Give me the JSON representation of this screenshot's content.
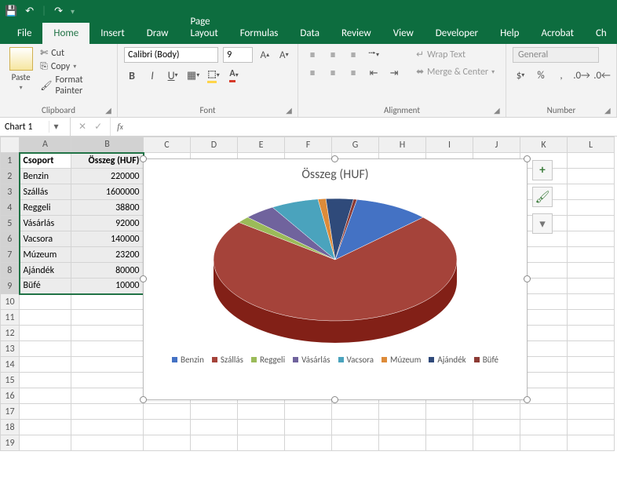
{
  "titlebar": {
    "save": "💾",
    "undo": "↶",
    "redo": "↷"
  },
  "tabs": [
    "File",
    "Home",
    "Insert",
    "Draw",
    "Page Layout",
    "Formulas",
    "Data",
    "Review",
    "View",
    "Developer",
    "Help",
    "Acrobat",
    "Ch"
  ],
  "active_tab": 1,
  "ribbon": {
    "clipboard": {
      "paste": "Paste",
      "cut": "Cut",
      "copy": "Copy",
      "painter": "Format Painter",
      "label": "Clipboard"
    },
    "font": {
      "name": "Calibri (Body)",
      "size": "9",
      "label": "Font"
    },
    "alignment": {
      "wrap": "Wrap Text",
      "merge": "Merge & Center",
      "label": "Alignment"
    },
    "number": {
      "format": "General",
      "label": "Number"
    }
  },
  "namebox": "Chart 1",
  "columns": [
    "A",
    "B",
    "C",
    "D",
    "E",
    "F",
    "G",
    "H",
    "I",
    "J",
    "K",
    "L"
  ],
  "headers": {
    "A": "Csoport",
    "B": "Összeg (HUF)"
  },
  "rows": [
    {
      "A": "Benzin",
      "B": "220000"
    },
    {
      "A": "Szállás",
      "B": "1600000"
    },
    {
      "A": "Reggeli",
      "B": "38800"
    },
    {
      "A": "Vásárlás",
      "B": "92000"
    },
    {
      "A": "Vacsora",
      "B": "140000"
    },
    {
      "A": "Múzeum",
      "B": "23200"
    },
    {
      "A": "Ajándék",
      "B": "80000"
    },
    {
      "A": "Büfé",
      "B": "10000"
    }
  ],
  "chart_title": "Összeg (HUF)",
  "chart_data": {
    "type": "pie",
    "title": "Összeg (HUF)",
    "categories": [
      "Benzin",
      "Szállás",
      "Reggeli",
      "Vásárlás",
      "Vacsora",
      "Múzeum",
      "Ajándék",
      "Büfé"
    ],
    "values": [
      220000,
      1600000,
      38800,
      92000,
      140000,
      23200,
      80000,
      10000
    ],
    "colors": [
      "#4472c4",
      "#a5433a",
      "#9bbb59",
      "#70639d",
      "#4aa3bd",
      "#dd8b39",
      "#2f4a7a",
      "#8c3a34"
    ],
    "style": "3d",
    "legend_position": "bottom"
  }
}
